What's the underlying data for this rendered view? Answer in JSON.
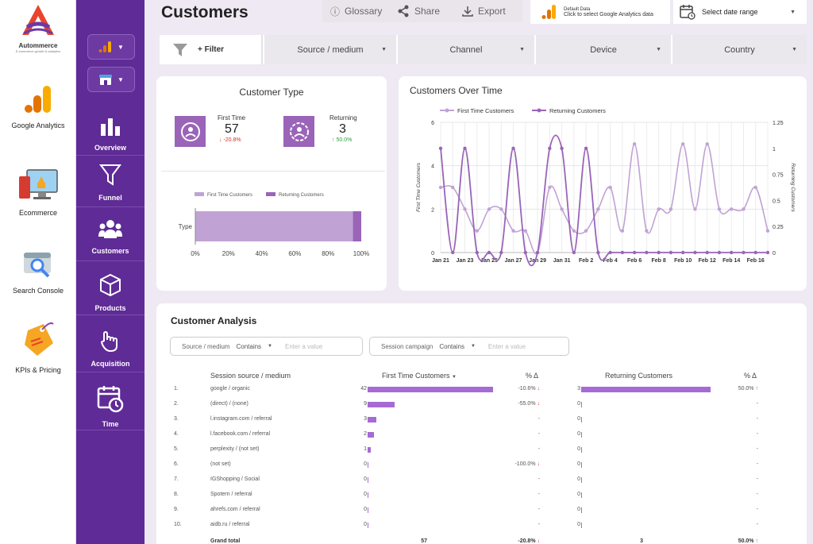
{
  "brand": {
    "name": "Autommerce",
    "tagline": "E-commerce growth & analytics"
  },
  "rail": [
    {
      "label": "Google Analytics"
    },
    {
      "label": "Ecommerce"
    },
    {
      "label": "Search Console"
    },
    {
      "label": "KPIs & Pricing"
    }
  ],
  "sidebar": {
    "items": [
      {
        "label": "Overview"
      },
      {
        "label": "Funnel"
      },
      {
        "label": "Customers"
      },
      {
        "label": "Products"
      },
      {
        "label": "Acquisition"
      },
      {
        "label": "Time"
      }
    ]
  },
  "header": {
    "title": "Customers",
    "glossary": "Glossary",
    "share": "Share",
    "export": "Export",
    "ga_line1": "Default Data",
    "ga_line2": "Click to select Google Analytics data",
    "date_label": "Select date range"
  },
  "filters": {
    "add": "+ Filter",
    "items": [
      "Source / medium",
      "Channel",
      "Device",
      "Country"
    ]
  },
  "customer_type": {
    "title": "Customer Type",
    "first_label": "First Time",
    "first_value": "57",
    "first_delta": "↓ -20.8%",
    "ret_label": "Returning",
    "ret_value": "3",
    "ret_delta": "↑ 50.0%"
  },
  "colors": {
    "purple_dark": "#5f2b96",
    "series_light": "#c0a3d4",
    "series_dark": "#9a64b8",
    "bar": "#a66ad4",
    "up": "#2e9e44",
    "down": "#d93025"
  },
  "chart_data": [
    {
      "type": "bar",
      "orientation": "horizontal-stacked-percent",
      "categories": [
        "Type"
      ],
      "series": [
        {
          "name": "First Time Customers",
          "values": [
            95
          ]
        },
        {
          "name": "Returning Customers",
          "values": [
            5
          ]
        }
      ],
      "xticks": [
        "0%",
        "20%",
        "40%",
        "60%",
        "80%",
        "100%"
      ],
      "xlim": [
        0,
        100
      ],
      "legend": "top"
    },
    {
      "type": "line",
      "title": "Customers Over Time",
      "x": [
        "Jan 21",
        "Jan 22",
        "Jan 23",
        "Jan 24",
        "Jan 25",
        "Jan 26",
        "Jan 27",
        "Jan 28",
        "Jan 29",
        "Jan 30",
        "Jan 31",
        "Feb 1",
        "Feb 2",
        "Feb 3",
        "Feb 4",
        "Feb 5",
        "Feb 6",
        "Feb 7",
        "Feb 8",
        "Feb 9",
        "Feb 10",
        "Feb 11",
        "Feb 12",
        "Feb 13",
        "Feb 14",
        "Feb 15",
        "Feb 16",
        "Feb 17"
      ],
      "xticks": [
        "Jan 21",
        "Jan 23",
        "Jan 25",
        "Jan 27",
        "Jan 29",
        "Jan 31",
        "Feb 2",
        "Feb 4",
        "Feb 6",
        "Feb 8",
        "Feb 10",
        "Feb 12",
        "Feb 14",
        "Feb 16"
      ],
      "series": [
        {
          "name": "First Time Customers",
          "axis": "left",
          "values": [
            3,
            3,
            2,
            1,
            2,
            2,
            1,
            1,
            0,
            3,
            2,
            1,
            1,
            2,
            3,
            1,
            5,
            1,
            2,
            2,
            5,
            2,
            5,
            2,
            2,
            2,
            3,
            1
          ]
        },
        {
          "name": "Returning Customers",
          "axis": "right",
          "values": [
            1,
            0,
            1,
            0,
            0,
            0,
            1,
            0,
            0,
            1,
            1,
            0,
            1,
            0,
            0,
            0,
            0,
            0,
            0,
            0,
            0,
            0,
            0,
            0,
            0,
            0,
            0,
            0
          ]
        }
      ],
      "ylabel": "First Time Customers",
      "y2label": "Returning Customers",
      "ylim": [
        0,
        6
      ],
      "yticks": [
        0,
        2,
        4,
        6
      ],
      "y2lim": [
        0,
        1.25
      ],
      "y2ticks": [
        0,
        0.25,
        0.5,
        0.75,
        1,
        1.25
      ],
      "grid": true,
      "legend": "top"
    }
  ],
  "analysis": {
    "title": "Customer Analysis",
    "filter1": {
      "field": "Source / medium",
      "op": "Contains",
      "placeholder": "Enter a value"
    },
    "filter2": {
      "field": "Session campaign",
      "op": "Contains",
      "placeholder": "Enter a value"
    },
    "headers": {
      "source": "Session source / medium",
      "first": "First Time Customers",
      "pct1": "% Δ",
      "ret": "Returning Customers",
      "pct2": "% Δ"
    },
    "rows": [
      {
        "n": "1.",
        "src": "google / organic",
        "first": 42,
        "p1": "-10.6%",
        "p1dir": "down",
        "ret": 3,
        "p2": "50.0%",
        "p2dir": "up"
      },
      {
        "n": "2.",
        "src": "(direct) / (none)",
        "first": 9,
        "p1": "-55.0%",
        "p1dir": "down",
        "ret": 0,
        "p2": "-",
        "p2dir": ""
      },
      {
        "n": "3.",
        "src": "l.instagram.com / referral",
        "first": 3,
        "p1": "-",
        "p1dir": "",
        "ret": 0,
        "p2": "-",
        "p2dir": ""
      },
      {
        "n": "4.",
        "src": "l.facebook.com / referral",
        "first": 2,
        "p1": "-",
        "p1dir": "",
        "ret": 0,
        "p2": "-",
        "p2dir": ""
      },
      {
        "n": "5.",
        "src": "perplexity / (not set)",
        "first": 1,
        "p1": "-",
        "p1dir": "",
        "ret": 0,
        "p2": "-",
        "p2dir": ""
      },
      {
        "n": "6.",
        "src": "(not set)",
        "first": 0,
        "p1": "-100.0%",
        "p1dir": "down",
        "ret": 0,
        "p2": "-",
        "p2dir": ""
      },
      {
        "n": "7.",
        "src": "IGShopping / Social",
        "first": 0,
        "p1": "-",
        "p1dir": "",
        "ret": 0,
        "p2": "-",
        "p2dir": ""
      },
      {
        "n": "8.",
        "src": "Spotern / referral",
        "first": 0,
        "p1": "-",
        "p1dir": "",
        "ret": 0,
        "p2": "-",
        "p2dir": ""
      },
      {
        "n": "9.",
        "src": "ahrefs.com / referral",
        "first": 0,
        "p1": "-",
        "p1dir": "",
        "ret": 0,
        "p2": "-",
        "p2dir": ""
      },
      {
        "n": "10.",
        "src": "aidb.ru / referral",
        "first": 0,
        "p1": "-",
        "p1dir": "",
        "ret": 0,
        "p2": "-",
        "p2dir": ""
      }
    ],
    "total": {
      "label": "Grand total",
      "first": "57",
      "p1": "-20.8%",
      "ret": "3",
      "p2": "50.0%"
    }
  }
}
